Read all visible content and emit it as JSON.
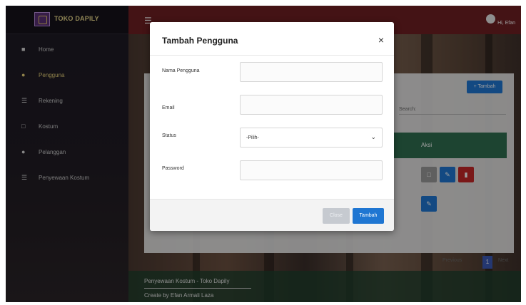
{
  "app": {
    "brand": "TOKO DAPILY"
  },
  "sidebar": {
    "items": [
      {
        "label": "Home",
        "icon": "home-icon"
      },
      {
        "label": "Pengguna",
        "icon": "user-icon"
      },
      {
        "label": "Rekening",
        "icon": "list-icon"
      },
      {
        "label": "Kostum",
        "icon": "shirt-icon"
      },
      {
        "label": "Pelanggan",
        "icon": "users-icon"
      },
      {
        "label": "Penyewaan Kostum",
        "icon": "list-icon"
      }
    ]
  },
  "topbar": {
    "user_name": "Hi, Efan"
  },
  "background": {
    "add_label": "+ Tambah",
    "search_label": "Search:",
    "table_header": "Aksi",
    "pager_prev": "Previous",
    "pager_page": "1",
    "pager_next": "Next"
  },
  "footer": {
    "line1": "Penyewaan Kostum - Toko Dapily",
    "line2": "Create by Efan Armali Laza"
  },
  "modal": {
    "title": "Tambah Pengguna",
    "close_symbol": "×",
    "fields": {
      "nama_label": "Nama Pengguna",
      "email_label": "Email",
      "status_label": "Status",
      "status_value": "-Pilih-",
      "password_label": "Password"
    },
    "close_button": "Close",
    "save_button": "Tambah"
  },
  "colors": {
    "topbar": "#6e1f23",
    "accent_blue": "#1f76d2",
    "table_header_green": "#2f6f4f",
    "brand_gold": "#e9d98c"
  }
}
